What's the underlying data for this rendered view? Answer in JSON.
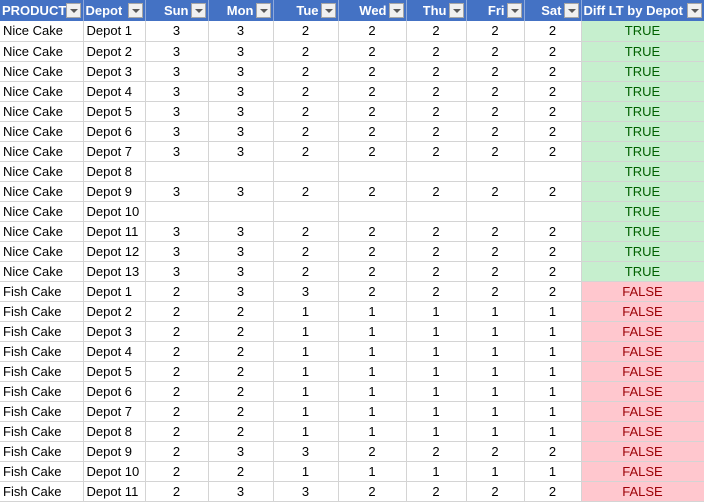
{
  "headers": [
    "PRODUCT_",
    "Depot",
    "Sun",
    "Mon",
    "Tue",
    "Wed",
    "Thu",
    "Fri",
    "Sat",
    "Diff LT by Depot"
  ],
  "colors": {
    "header_bg": "#4472c4",
    "true_bg": "#c6efce",
    "true_fg": "#006100",
    "false_bg": "#ffc7ce",
    "false_fg": "#9c0006"
  },
  "rows": [
    [
      "Nice Cake",
      "Depot 1",
      "3",
      "3",
      "2",
      "2",
      "2",
      "2",
      "2",
      "TRUE"
    ],
    [
      "Nice Cake",
      "Depot 2",
      "3",
      "3",
      "2",
      "2",
      "2",
      "2",
      "2",
      "TRUE"
    ],
    [
      "Nice Cake",
      "Depot 3",
      "3",
      "3",
      "2",
      "2",
      "2",
      "2",
      "2",
      "TRUE"
    ],
    [
      "Nice Cake",
      "Depot 4",
      "3",
      "3",
      "2",
      "2",
      "2",
      "2",
      "2",
      "TRUE"
    ],
    [
      "Nice Cake",
      "Depot 5",
      "3",
      "3",
      "2",
      "2",
      "2",
      "2",
      "2",
      "TRUE"
    ],
    [
      "Nice Cake",
      "Depot 6",
      "3",
      "3",
      "2",
      "2",
      "2",
      "2",
      "2",
      "TRUE"
    ],
    [
      "Nice Cake",
      "Depot 7",
      "3",
      "3",
      "2",
      "2",
      "2",
      "2",
      "2",
      "TRUE"
    ],
    [
      "Nice Cake",
      "Depot 8",
      "",
      "",
      "",
      "",
      "",
      "",
      "",
      "TRUE"
    ],
    [
      "Nice Cake",
      "Depot 9",
      "3",
      "3",
      "2",
      "2",
      "2",
      "2",
      "2",
      "TRUE"
    ],
    [
      "Nice Cake",
      "Depot 10",
      "",
      "",
      "",
      "",
      "",
      "",
      "",
      "TRUE"
    ],
    [
      "Nice Cake",
      "Depot 11",
      "3",
      "3",
      "2",
      "2",
      "2",
      "2",
      "2",
      "TRUE"
    ],
    [
      "Nice Cake",
      "Depot 12",
      "3",
      "3",
      "2",
      "2",
      "2",
      "2",
      "2",
      "TRUE"
    ],
    [
      "Nice Cake",
      "Depot 13",
      "3",
      "3",
      "2",
      "2",
      "2",
      "2",
      "2",
      "TRUE"
    ],
    [
      "Fish Cake",
      "Depot 1",
      "2",
      "3",
      "3",
      "2",
      "2",
      "2",
      "2",
      "FALSE"
    ],
    [
      "Fish Cake",
      "Depot 2",
      "2",
      "2",
      "1",
      "1",
      "1",
      "1",
      "1",
      "FALSE"
    ],
    [
      "Fish Cake",
      "Depot 3",
      "2",
      "2",
      "1",
      "1",
      "1",
      "1",
      "1",
      "FALSE"
    ],
    [
      "Fish Cake",
      "Depot 4",
      "2",
      "2",
      "1",
      "1",
      "1",
      "1",
      "1",
      "FALSE"
    ],
    [
      "Fish Cake",
      "Depot 5",
      "2",
      "2",
      "1",
      "1",
      "1",
      "1",
      "1",
      "FALSE"
    ],
    [
      "Fish Cake",
      "Depot 6",
      "2",
      "2",
      "1",
      "1",
      "1",
      "1",
      "1",
      "FALSE"
    ],
    [
      "Fish Cake",
      "Depot 7",
      "2",
      "2",
      "1",
      "1",
      "1",
      "1",
      "1",
      "FALSE"
    ],
    [
      "Fish Cake",
      "Depot 8",
      "2",
      "2",
      "1",
      "1",
      "1",
      "1",
      "1",
      "FALSE"
    ],
    [
      "Fish Cake",
      "Depot 9",
      "2",
      "3",
      "3",
      "2",
      "2",
      "2",
      "2",
      "FALSE"
    ],
    [
      "Fish Cake",
      "Depot 10",
      "2",
      "2",
      "1",
      "1",
      "1",
      "1",
      "1",
      "FALSE"
    ],
    [
      "Fish Cake",
      "Depot 11",
      "2",
      "3",
      "3",
      "2",
      "2",
      "2",
      "2",
      "FALSE"
    ]
  ]
}
